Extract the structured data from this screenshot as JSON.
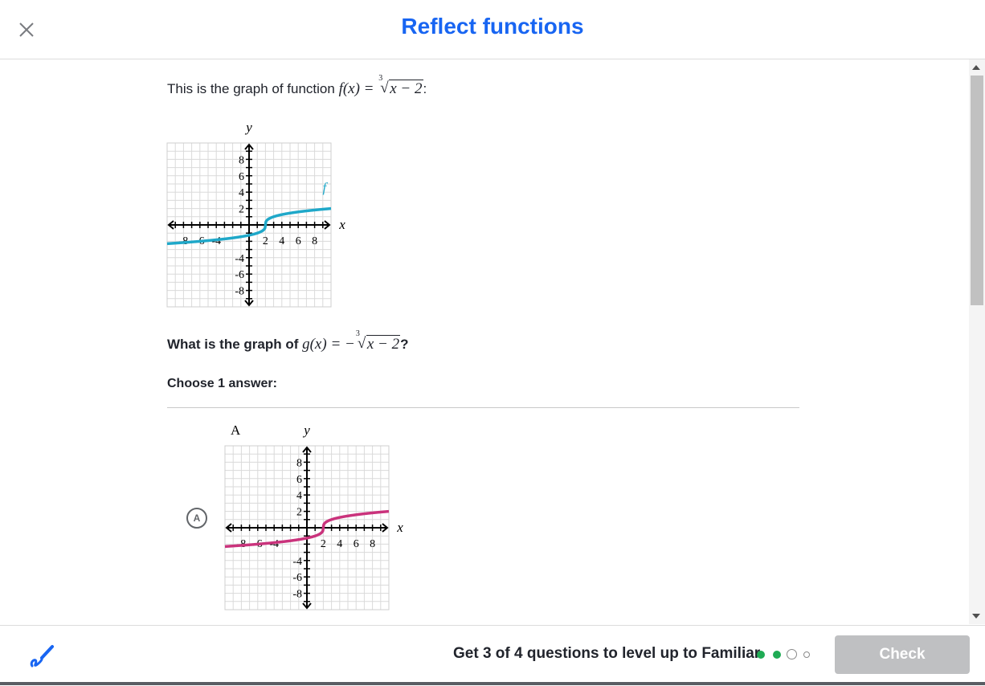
{
  "header": {
    "title": "Reflect functions",
    "close_icon": "close-icon"
  },
  "question": {
    "intro": "This is the graph of function ",
    "f_lhs": "f(x) = ",
    "f_index": "3",
    "f_arg": "x − 2",
    "f_tail": ":",
    "prompt": "What is the graph of ",
    "g_lhs": "g(x) = −",
    "g_index": "3",
    "g_arg": "x − 2",
    "prompt_tail": "?",
    "choose_label": "Choose 1 answer:"
  },
  "graphs": {
    "main": {
      "x_label": "x",
      "y_label": "y",
      "curve_label": "f",
      "curve_color": "#1fa8c9",
      "ticks_x_neg": [
        "-8",
        "-6",
        "-4"
      ],
      "ticks_x_pos": [
        "2",
        "4",
        "6",
        "8"
      ],
      "ticks_y_pos": [
        "8",
        "6",
        "4",
        "2"
      ],
      "ticks_y_neg": [
        "-4",
        "-6",
        "-8"
      ]
    },
    "option_a": {
      "graph_letter": "A",
      "x_label": "x",
      "y_label": "y",
      "curve_color": "#ca337c",
      "ticks_x_neg": [
        "-8",
        "-6",
        "-4"
      ],
      "ticks_x_pos": [
        "2",
        "4",
        "6",
        "8"
      ],
      "ticks_y_pos": [
        "8",
        "6",
        "4",
        "2"
      ],
      "ticks_y_neg": [
        "-4",
        "-6",
        "-8"
      ]
    }
  },
  "options": [
    {
      "letter": "A"
    }
  ],
  "footer": {
    "scratchpad_icon": "pencil-icon",
    "level_text": "Get 3 of 4 questions to level up to Familiar",
    "check_label": "Check",
    "progress": {
      "completed": 2,
      "total": 4
    },
    "colors": {
      "done": "#1fab54",
      "pending": "#bababa",
      "button_disabled": "#bfc0c2"
    }
  },
  "colors": {
    "accent": "#1865f2"
  }
}
